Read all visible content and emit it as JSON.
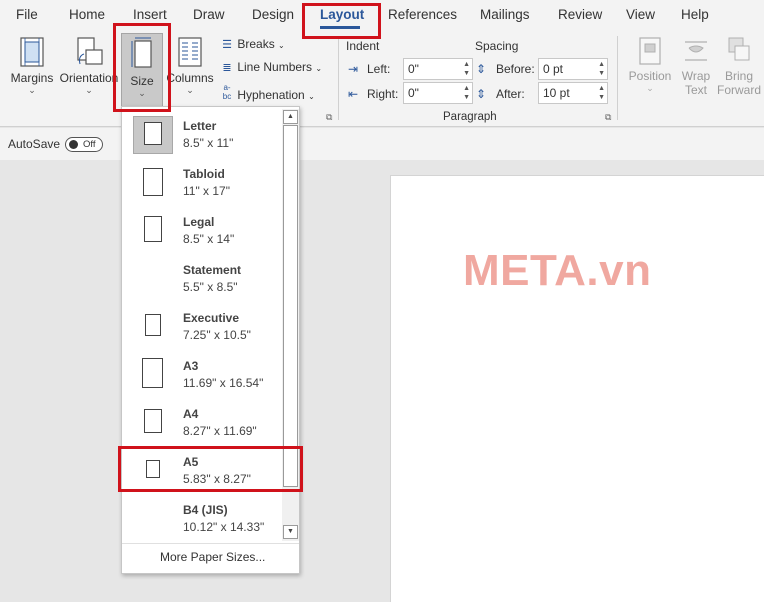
{
  "menu_tabs": [
    "File",
    "Home",
    "Insert",
    "Draw",
    "Design",
    "Layout",
    "References",
    "Mailings",
    "Review",
    "View",
    "Help"
  ],
  "ribbon": {
    "page_setup": {
      "margins": "Margins",
      "orientation": "Orientation",
      "size": "Size",
      "columns": "Columns",
      "breaks": "Breaks",
      "line_numbers": "Line Numbers",
      "hyphenation": "Hyphenation"
    },
    "paragraph": {
      "indent_title": "Indent",
      "spacing_title": "Spacing",
      "left_label": "Left:",
      "left_value": "0\"",
      "right_label": "Right:",
      "right_value": "0\"",
      "before_label": "Before:",
      "before_value": "0 pt",
      "after_label": "After:",
      "after_value": "10 pt",
      "group_label": "Paragraph"
    },
    "arrange": {
      "position": "Position",
      "wrap_text_1": "Wrap",
      "wrap_text_2": "Text",
      "bring_forward_1": "Bring",
      "bring_forward_2": "Forward"
    }
  },
  "autosave": {
    "label": "AutoSave",
    "state": "Off"
  },
  "size_dropdown": {
    "items": [
      {
        "name": "Letter",
        "dimensions": "8.5\" x 11\"",
        "selected": true
      },
      {
        "name": "Tabloid",
        "dimensions": "11\" x 17\""
      },
      {
        "name": "Legal",
        "dimensions": "8.5\" x 14\""
      },
      {
        "name": "Statement",
        "dimensions": "5.5\" x 8.5\""
      },
      {
        "name": "Executive",
        "dimensions": "7.25\" x 10.5\""
      },
      {
        "name": "A3",
        "dimensions": "11.69\" x 16.54\""
      },
      {
        "name": "A4",
        "dimensions": "8.27\" x 11.69\""
      },
      {
        "name": "A5",
        "dimensions": "5.83\" x 8.27\"",
        "highlighted": true
      },
      {
        "name": "B4 (JIS)",
        "dimensions": "10.12\" x 14.33\""
      }
    ],
    "more": "More Paper Sizes..."
  },
  "watermark": "META.vn",
  "colors": {
    "highlight": "#d0121b",
    "accent": "#2b579a",
    "watermark": "#f0a8a0"
  }
}
